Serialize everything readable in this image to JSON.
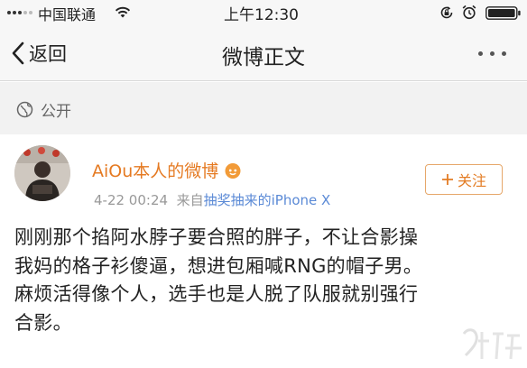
{
  "status_bar": {
    "carrier": "中国联通",
    "time": "上午12:30"
  },
  "nav": {
    "back_label": "返回",
    "title": "微博正文"
  },
  "visibility": {
    "label": "公开"
  },
  "post": {
    "username": "AiOu本人的微博",
    "date": "4-22 00:24",
    "source_prefix": "来自",
    "source": "抽奖抽来的iPhone X",
    "follow_label": "关注",
    "body_lines": [
      "刚刚那个掐阿水脖子要合照的胖子，不让合影操",
      "我妈的格子衫傻逼，想进包厢喊RNG的帽子男。",
      "麻烦活得像个人，选手也是人脱了队服就别强行",
      "合影。"
    ]
  },
  "colors": {
    "username": "#e57a22",
    "source_link": "#5b8ad6",
    "follow_border": "#e6a76a"
  },
  "icons": [
    "signal-icon",
    "wifi-icon",
    "rotation-lock-icon",
    "alarm-icon",
    "battery-icon",
    "back-chevron-icon",
    "more-icon",
    "globe-icon",
    "verified-badge-icon",
    "plus-icon"
  ]
}
